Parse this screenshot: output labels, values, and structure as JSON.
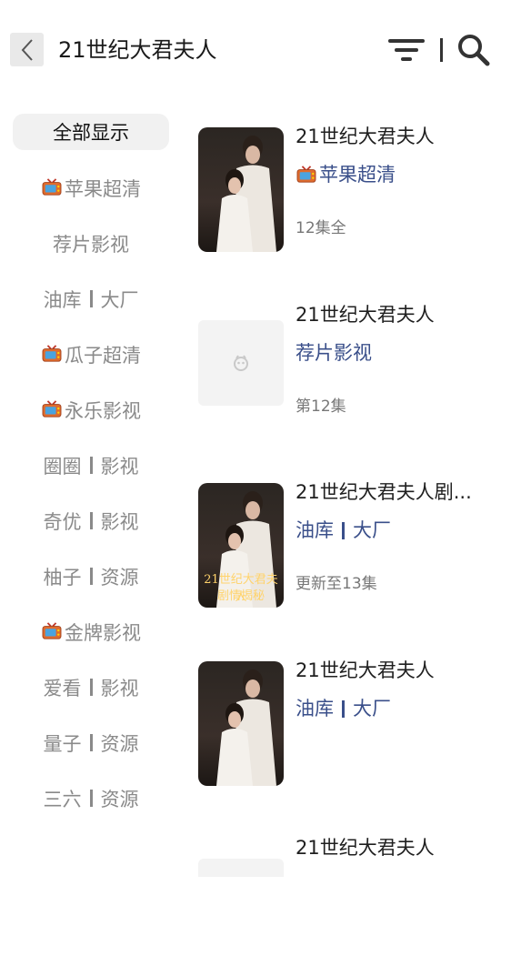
{
  "header": {
    "title": "21世纪大君夫人"
  },
  "sidebar": {
    "items": [
      {
        "label": "全部显示",
        "type": "plain",
        "active": true
      },
      {
        "label": "苹果超清",
        "type": "tv"
      },
      {
        "label": "荐片影视",
        "type": "plain"
      },
      {
        "left": "油库",
        "right": "大厂",
        "type": "split"
      },
      {
        "label": "瓜子超清",
        "type": "tv"
      },
      {
        "label": "永乐影视",
        "type": "tv"
      },
      {
        "left": "圈圈",
        "right": "影视",
        "type": "split"
      },
      {
        "left": "奇优",
        "right": "影视",
        "type": "split"
      },
      {
        "left": "柚子",
        "right": "资源",
        "type": "split"
      },
      {
        "label": "金牌影视",
        "type": "tv"
      },
      {
        "left": "爱看",
        "right": "影视",
        "type": "split"
      },
      {
        "left": "量子",
        "right": "资源",
        "type": "split"
      },
      {
        "left": "三六",
        "right": "资源",
        "type": "split"
      }
    ]
  },
  "results": [
    {
      "title": "21世纪大君夫人",
      "source": "苹果超清",
      "source_type": "tv",
      "episodes": "12集全",
      "poster": "poster1"
    },
    {
      "title": "21世纪大君夫人",
      "source": "荐片影视",
      "source_type": "plain",
      "episodes": "第12集",
      "poster": "placeholder"
    },
    {
      "title": "21世纪大君夫人剧...",
      "source_left": "油库",
      "source_right": "大厂",
      "source_type": "split",
      "episodes": "更新至13集",
      "poster": "poster3",
      "poster_line1": "21世纪大君夫人",
      "poster_line2": "剧情揭秘"
    },
    {
      "title": "21世纪大君夫人",
      "source_left": "油库",
      "source_right": "大厂",
      "source_type": "split",
      "episodes": "",
      "poster": "poster4"
    },
    {
      "title": "21世纪大君夫人",
      "source": "",
      "source_type": "none",
      "episodes": "",
      "poster": "placeholder-partial"
    }
  ],
  "colors": {
    "source_text": "#3a4f8a",
    "sidebar_text": "#8a8a8a",
    "active_bg": "#f1f1f1"
  },
  "icons": {
    "back": "chevron-left-icon",
    "filter": "filter-icon",
    "search": "search-icon",
    "tv": "tv-icon"
  }
}
